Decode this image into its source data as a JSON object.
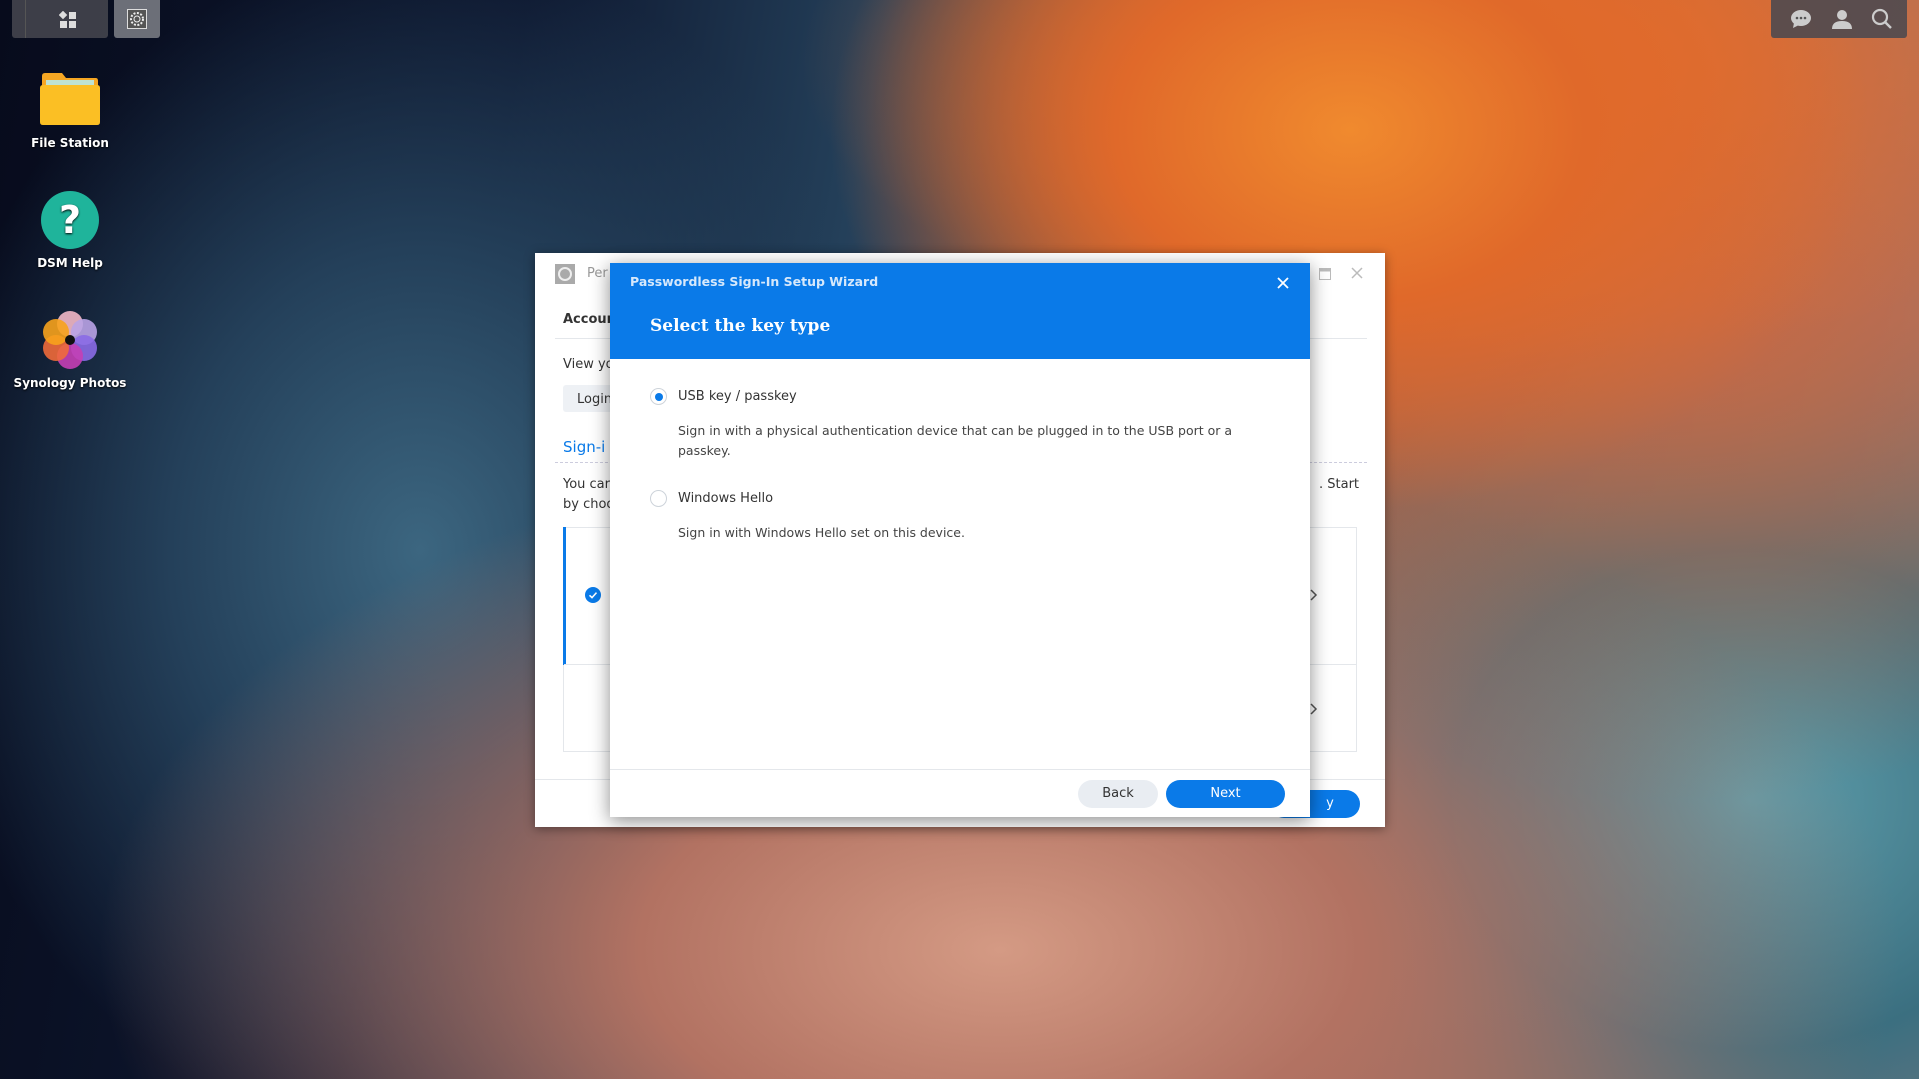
{
  "taskbar": {
    "main_menu_icon": "grid-icon",
    "open_app_icon": "control-panel-gear-icon"
  },
  "tray": {
    "icons": [
      "chat-icon",
      "user-icon",
      "search-icon"
    ]
  },
  "desktop": {
    "icons": [
      {
        "label": "File Station",
        "icon": "folder-icon"
      },
      {
        "label": "DSM Help",
        "icon": "help-icon"
      },
      {
        "label": "Synology Photos",
        "icon": "photos-icon"
      }
    ]
  },
  "background_window": {
    "title": "Per",
    "tab": "Accoun",
    "view_text": "View yo",
    "login_button": "Login",
    "section_title": "Sign-i",
    "desc_line1": "You car",
    "desc_line2": "by choo",
    "desc_right": ". Start",
    "apply_button": "y"
  },
  "wizard": {
    "title": "Passwordless Sign-In Setup Wizard",
    "heading": "Select the key type",
    "options": [
      {
        "label": "USB key / passkey",
        "description": "Sign in with a physical authentication device that can be plugged in to the USB port or a passkey.",
        "selected": true
      },
      {
        "label": "Windows Hello",
        "description": "Sign in with Windows Hello set on this device.",
        "selected": false
      }
    ],
    "back_button": "Back",
    "next_button": "Next"
  },
  "colors": {
    "accent": "#0a7ae8"
  }
}
